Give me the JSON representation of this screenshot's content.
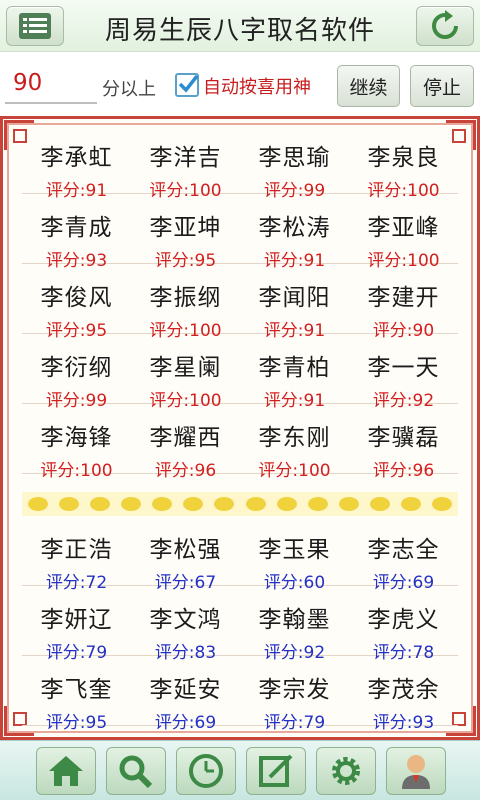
{
  "header": {
    "title": "周易生辰八字取名软件",
    "menu_icon": "list-icon",
    "refresh_icon": "refresh-icon"
  },
  "controls": {
    "min_score_value": "90",
    "above_label": "分以上",
    "auto_checked": true,
    "auto_label": "自动按喜用神",
    "continue_label": "继续",
    "stop_label": "停止"
  },
  "names_high": [
    [
      {
        "name": "李承虹",
        "score": "评分:91"
      },
      {
        "name": "李洋吉",
        "score": "评分:100"
      },
      {
        "name": "李思瑜",
        "score": "评分:99"
      },
      {
        "name": "李泉良",
        "score": "评分:100"
      }
    ],
    [
      {
        "name": "李青成",
        "score": "评分:93"
      },
      {
        "name": "李亚坤",
        "score": "评分:95"
      },
      {
        "name": "李松涛",
        "score": "评分:91"
      },
      {
        "name": "李亚峰",
        "score": "评分:100"
      }
    ],
    [
      {
        "name": "李俊风",
        "score": "评分:95"
      },
      {
        "name": "李振纲",
        "score": "评分:100"
      },
      {
        "name": "李闻阳",
        "score": "评分:91"
      },
      {
        "name": "李建开",
        "score": "评分:90"
      }
    ],
    [
      {
        "name": "李衍纲",
        "score": "评分:99"
      },
      {
        "name": "李星阑",
        "score": "评分:100"
      },
      {
        "name": "李青柏",
        "score": "评分:91"
      },
      {
        "name": "李一天",
        "score": "评分:92"
      }
    ],
    [
      {
        "name": "李海锋",
        "score": "评分:100"
      },
      {
        "name": "李耀西",
        "score": "评分:96"
      },
      {
        "name": "李东刚",
        "score": "评分:100"
      },
      {
        "name": "李骥磊",
        "score": "评分:96"
      }
    ]
  ],
  "names_all": [
    [
      {
        "name": "李正浩",
        "score": "评分:72"
      },
      {
        "name": "李松强",
        "score": "评分:67"
      },
      {
        "name": "李玉果",
        "score": "评分:60"
      },
      {
        "name": "李志全",
        "score": "评分:69"
      }
    ],
    [
      {
        "name": "李妍辽",
        "score": "评分:79"
      },
      {
        "name": "李文鸿",
        "score": "评分:83"
      },
      {
        "name": "李翰墨",
        "score": "评分:92"
      },
      {
        "name": "李虎义",
        "score": "评分:78"
      }
    ],
    [
      {
        "name": "李飞奎",
        "score": "评分:95"
      },
      {
        "name": "李延安",
        "score": "评分:69"
      },
      {
        "name": "李宗发",
        "score": "评分:79"
      },
      {
        "name": "李茂余",
        "score": "评分:93"
      }
    ]
  ],
  "colors": {
    "high_score": "#d21f1f",
    "other_score": "#2330c4",
    "frame": "#c8433a"
  },
  "bottom_nav": [
    "home-icon",
    "search-icon",
    "clock-icon",
    "edit-icon",
    "gear-icon",
    "user-icon"
  ]
}
